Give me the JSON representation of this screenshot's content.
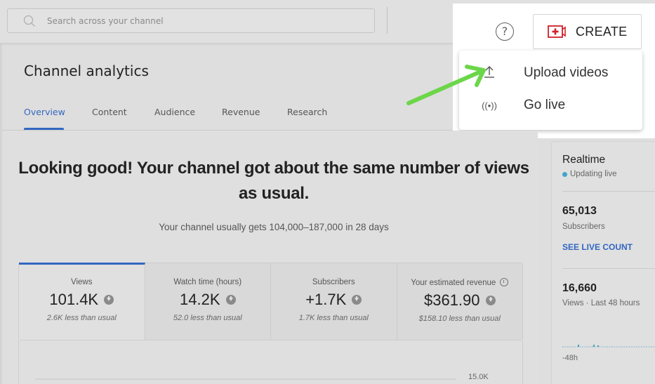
{
  "search": {
    "placeholder": "Search across your channel"
  },
  "header": {
    "help_icon": "?",
    "create_label": "CREATE"
  },
  "create_menu": {
    "items": [
      {
        "icon": "upload-icon",
        "glyph": "↑",
        "label": "Upload videos"
      },
      {
        "icon": "live-icon",
        "glyph": "((•))",
        "label": "Go live"
      }
    ]
  },
  "page": {
    "title": "Channel analytics"
  },
  "tabs": [
    {
      "label": "Overview",
      "active": true
    },
    {
      "label": "Content",
      "active": false
    },
    {
      "label": "Audience",
      "active": false
    },
    {
      "label": "Revenue",
      "active": false
    },
    {
      "label": "Research",
      "active": false
    }
  ],
  "summary": {
    "headline": "Looking good! Your channel got about the same number of views as usual.",
    "subline": "Your channel usually gets 104,000–187,000 in 28 days"
  },
  "metrics": [
    {
      "label": "Views",
      "value": "101.4K",
      "delta": "2.6K less than usual",
      "trend": "down",
      "active": true
    },
    {
      "label": "Watch time (hours)",
      "value": "14.2K",
      "delta": "52.0 less than usual",
      "trend": "down",
      "active": false
    },
    {
      "label": "Subscribers",
      "value": "+1.7K",
      "delta": "1.7K less than usual",
      "trend": "down",
      "active": false
    },
    {
      "label": "Your estimated revenue",
      "value": "$361.90",
      "delta": "$158.10 less than usual",
      "trend": "down",
      "active": false,
      "has_clock_icon": true
    }
  ],
  "chart": {
    "tick_label": "15.0K"
  },
  "realtime": {
    "title": "Realtime",
    "status": "Updating live",
    "subscribers_value": "65,013",
    "subscribers_label": "Subscribers",
    "see_live_count": "SEE LIVE COUNT",
    "views_value": "16,660",
    "views_label": "Views · Last 48 hours",
    "axis_label": "-48h"
  },
  "colors": {
    "accent": "#3367c2",
    "live_dot": "#3ea6c8",
    "create_icon": "#d0202a",
    "annotation_arrow": "#6cd64a"
  }
}
